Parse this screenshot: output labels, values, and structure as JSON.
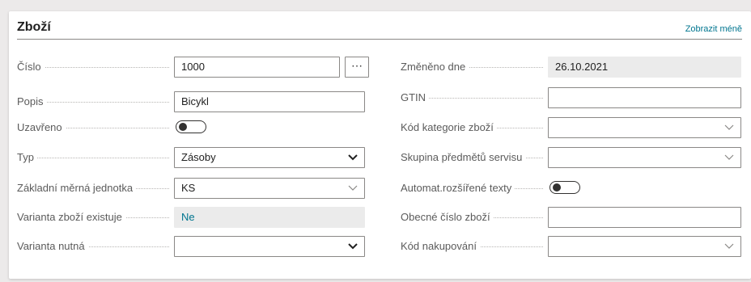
{
  "card": {
    "title": "Zboží",
    "show_less": "Zobrazit méně"
  },
  "left": [
    {
      "label": "Číslo",
      "value": "1000"
    },
    {
      "label": "Popis",
      "value": "Bicykl"
    },
    {
      "label": "Uzavřeno",
      "toggle": false
    },
    {
      "label": "Typ",
      "value": "Zásoby"
    },
    {
      "label": "Základní měrná jednotka",
      "value": "KS"
    },
    {
      "label": "Varianta zboží existuje",
      "value": "Ne"
    },
    {
      "label": "Varianta nutná",
      "value": ""
    }
  ],
  "right": [
    {
      "label": "Změněno dne",
      "value": "26.10.2021"
    },
    {
      "label": "GTIN",
      "value": ""
    },
    {
      "label": "Kód kategorie zboží",
      "value": ""
    },
    {
      "label": "Skupina předmětů servisu",
      "value": ""
    },
    {
      "label": "Automat.rozšířené texty",
      "toggle": false
    },
    {
      "label": "Obecné číslo zboží",
      "value": ""
    },
    {
      "label": "Kód nakupování",
      "value": ""
    }
  ],
  "assist_button_label": "⋯",
  "icons": {
    "chevron": "chevron-down-icon",
    "assist": "ellipsis-icon"
  },
  "colors": {
    "link": "#00758f",
    "readonly_bg": "#ebebeb",
    "border": "#8a8886"
  }
}
